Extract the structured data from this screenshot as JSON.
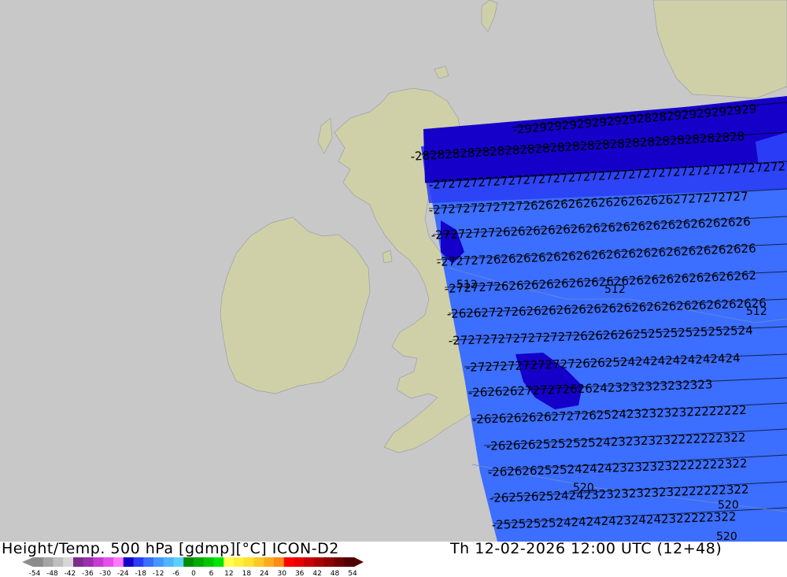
{
  "header": {
    "title_left": "Height/Temp. 500 hPa [gdmp][°C] ICON-D2",
    "title_right": "Th 12-02-2026 12:00 UTC (12+48)"
  },
  "map": {
    "ocean_color": "#c8c8c8",
    "land_color": "#cfd0a8",
    "contour_labels": [
      "29",
      "28",
      "27",
      "27",
      "27",
      "26",
      "26",
      "26",
      "25",
      "25",
      "24",
      "24",
      "23",
      "23",
      "22",
      "22"
    ],
    "height_labels": [
      "512",
      "512",
      "512",
      "520",
      "520",
      "520"
    ]
  },
  "legend": {
    "tick_labels": [
      "-54",
      "-48",
      "-42",
      "-36",
      "-30",
      "-24",
      "-18",
      "-12",
      "-6",
      "0",
      "6",
      "12",
      "18",
      "24",
      "30",
      "36",
      "42",
      "48",
      "54"
    ],
    "colors": [
      "#8c8c8c",
      "#a5a5a5",
      "#bebebe",
      "#d7d7d7",
      "#7b2d8e",
      "#9b2fae",
      "#c43cd2",
      "#e650e6",
      "#ff78ff",
      "#1400c8",
      "#2a3cf5",
      "#3c6eff",
      "#4696ff",
      "#50b4ff",
      "#5ad2ff",
      "#008c00",
      "#00aa00",
      "#00c800",
      "#00e600",
      "#ffff50",
      "#fff03c",
      "#ffe132",
      "#ffc828",
      "#ffaa1e",
      "#ff8c14",
      "#ff0000",
      "#e60000",
      "#c80000",
      "#aa0000",
      "#8c0000",
      "#6e0000",
      "#500000"
    ]
  }
}
